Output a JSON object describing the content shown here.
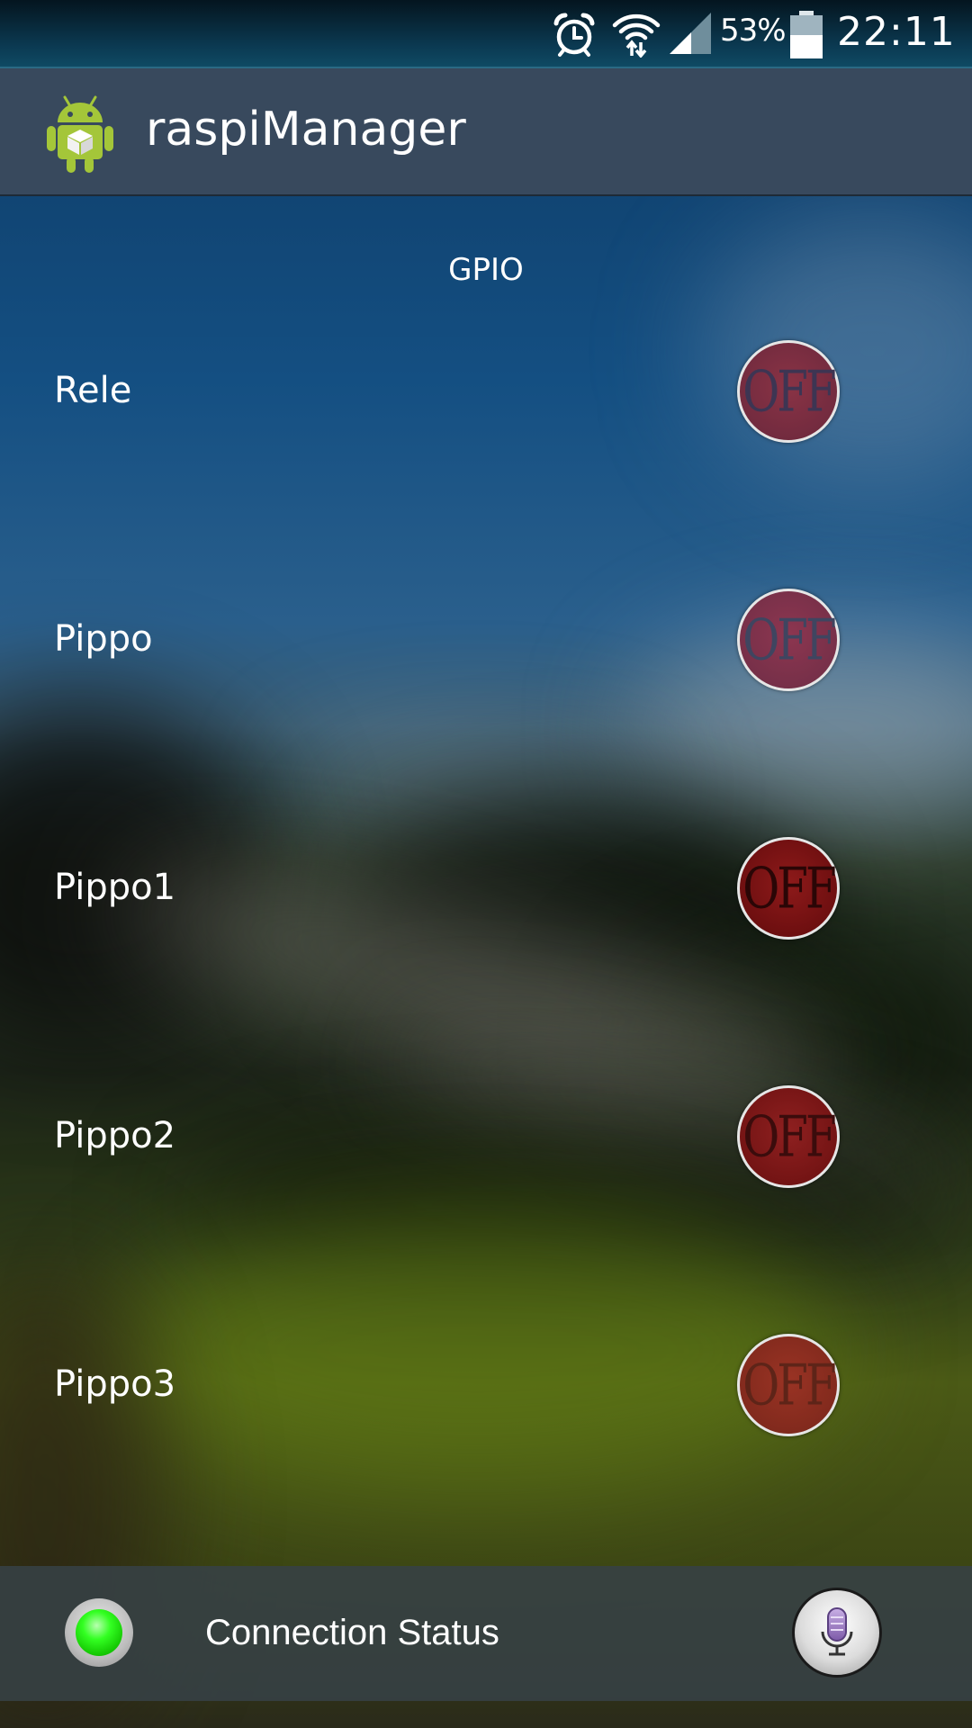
{
  "status_bar": {
    "battery_percent": "53%",
    "time": "22:11",
    "icons": [
      "alarm-icon",
      "wifi-icon",
      "signal-icon",
      "battery-icon"
    ]
  },
  "action_bar": {
    "title": "raspiManager",
    "icon": "android-app-icon"
  },
  "main": {
    "section_title": "GPIO",
    "gpio_items": [
      {
        "label": "Rele",
        "state": "OFF"
      },
      {
        "label": "Pippo",
        "state": "OFF"
      },
      {
        "label": "Pippo1",
        "state": "OFF"
      },
      {
        "label": "Pippo2",
        "state": "OFF"
      },
      {
        "label": "Pippo3",
        "state": "OFF"
      }
    ]
  },
  "bottom_bar": {
    "connection_label": "Connection Status",
    "led_color": "#22ee11",
    "mic_icon": "microphone-icon"
  },
  "colors": {
    "action_bar_bg": "#38495d",
    "toggle_off": "#7a1f2a"
  }
}
